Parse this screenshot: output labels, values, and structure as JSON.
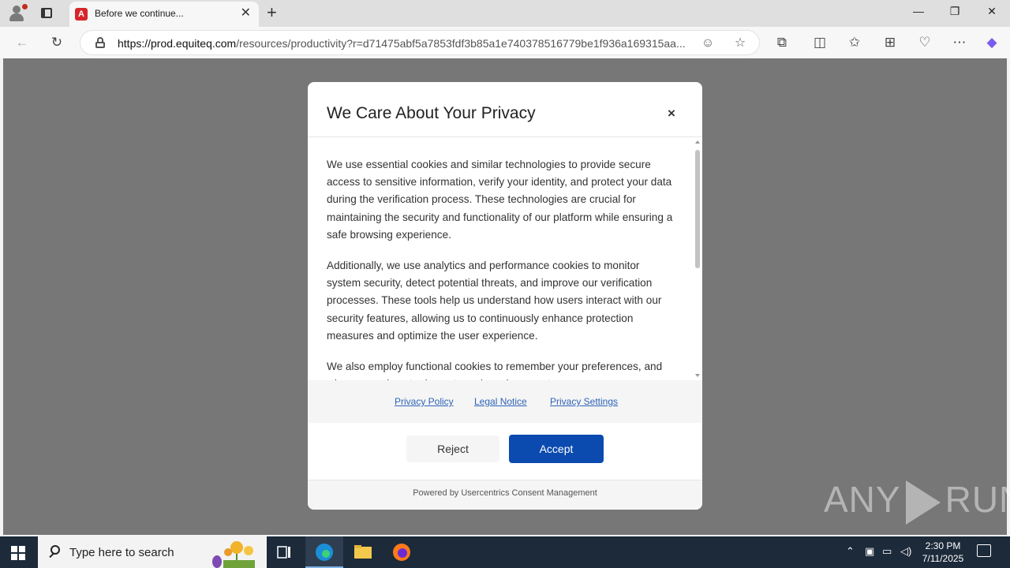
{
  "browser": {
    "tab": {
      "title": "Before we continue...",
      "favicon_letter": "A"
    },
    "url": {
      "host": "https://prod.equiteq.com",
      "path": "/resources/productivity?r=d71475abf5a7853fdf3b85a1e740378516779be1f936a169315aa..."
    }
  },
  "modal": {
    "title": "We Care About Your Privacy",
    "close_label": "×",
    "paragraphs": [
      "We use essential cookies and similar technologies to provide secure access to sensitive information, verify your identity, and protect your data during the verification process. These technologies are crucial for maintaining the security and functionality of our platform while ensuring a safe browsing experience.",
      "Additionally, we use analytics and performance cookies to monitor system security, detect potential threats, and improve our verification processes. These tools help us understand how users interact with our security features, allowing us to continuously enhance protection measures and optimize the user experience.",
      "We also employ functional cookies to remember your preferences, and when you ask us to do so, to make subsequent..."
    ],
    "links": {
      "privacy_policy": "Privacy Policy",
      "legal_notice": "Legal Notice",
      "privacy_settings": "Privacy Settings"
    },
    "buttons": {
      "reject": "Reject",
      "accept": "Accept"
    },
    "footer": "Powered by Usercentrics Consent Management",
    "accent_color": "#0b4bb0"
  },
  "watermark": {
    "left": "ANY",
    "right": "RUN"
  },
  "taskbar": {
    "search_placeholder": "Type here to search",
    "time": "2:30 PM",
    "date": "7/11/2025"
  }
}
